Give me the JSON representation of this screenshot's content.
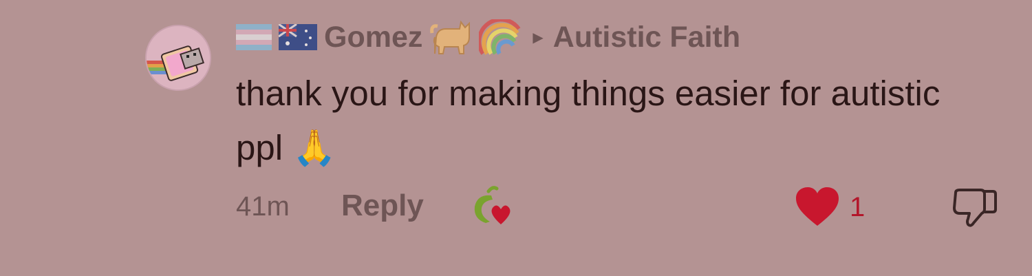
{
  "comment": {
    "username": "Gomez",
    "community": "Autistic Faith",
    "body": "thank you for making things easier for autistic ppl 🙏",
    "time": "41m",
    "reply_label": "Reply",
    "like_count": "1",
    "flair_icons": [
      "trans-flag-icon",
      "australia-flag-icon",
      "cat-icon",
      "rainbow-icon"
    ],
    "colors": {
      "background": "#b49393",
      "accent": "#c8172e",
      "muted": "#6e5555"
    }
  }
}
